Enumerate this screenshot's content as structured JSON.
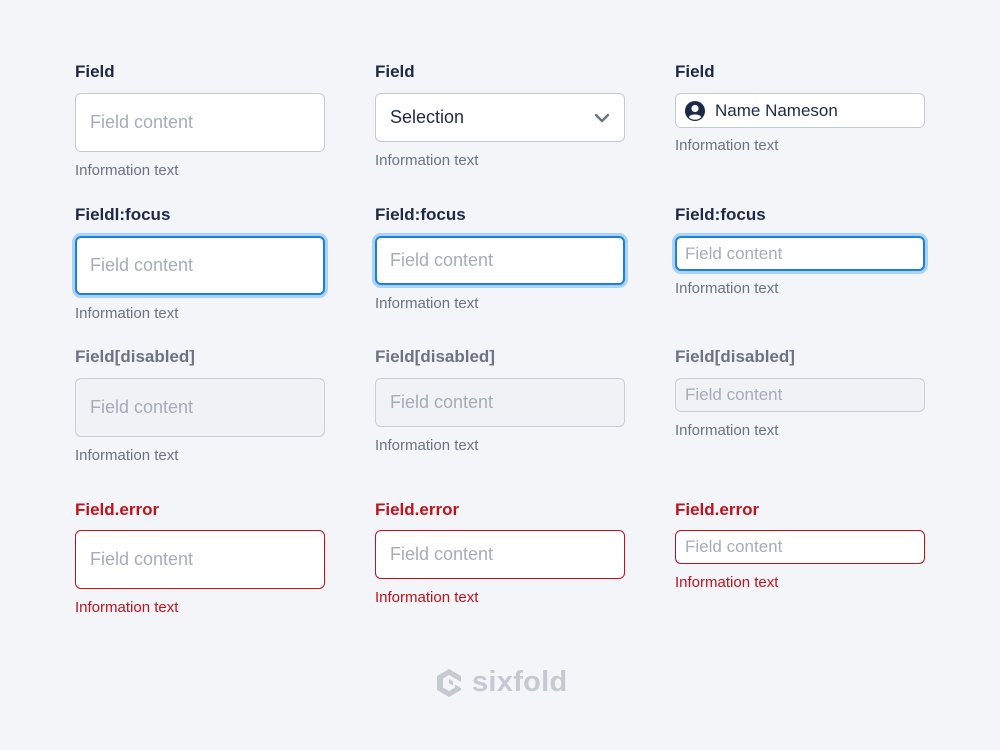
{
  "rows": [
    {
      "col1": {
        "label": "Field",
        "text": "Field content",
        "info": "Information text"
      },
      "col2": {
        "label": "Field",
        "text": "Selection",
        "info": "Information text",
        "icon": "chevron-down-icon"
      },
      "col3": {
        "label": "Field",
        "text": "Name Nameson",
        "info": "Information text",
        "icon": "user-avatar-icon"
      }
    },
    {
      "col1": {
        "label": "Fieldl:focus",
        "text": "Field content",
        "info": "Information text"
      },
      "col2": {
        "label": "Field:focus",
        "text": "Field content",
        "info": "Information text"
      },
      "col3": {
        "label": "Field:focus",
        "text": "Field content",
        "info": "Information text"
      }
    },
    {
      "col1": {
        "label": "Field[disabled]",
        "text": "Field content",
        "info": "Information text"
      },
      "col2": {
        "label": "Field[disabled]",
        "text": "Field content",
        "info": "Information text"
      },
      "col3": {
        "label": "Field[disabled]",
        "text": "Field content",
        "info": "Information text"
      }
    },
    {
      "col1": {
        "label": "Field.error",
        "text": "Field content",
        "info": "Information text"
      },
      "col2": {
        "label": "Field.error",
        "text": "Field content",
        "info": "Information text"
      },
      "col3": {
        "label": "Field.error",
        "text": "Field content",
        "info": "Information text"
      }
    }
  ],
  "brand": {
    "name": "sixfold",
    "icon": "sixfold-logo-icon"
  },
  "colors": {
    "background": "#f3f5f8",
    "label": "#1c2a48",
    "focus": "#1e7fd9",
    "error": "#c1121c",
    "muted": "#6b7384",
    "placeholder": "#a6adb8"
  }
}
